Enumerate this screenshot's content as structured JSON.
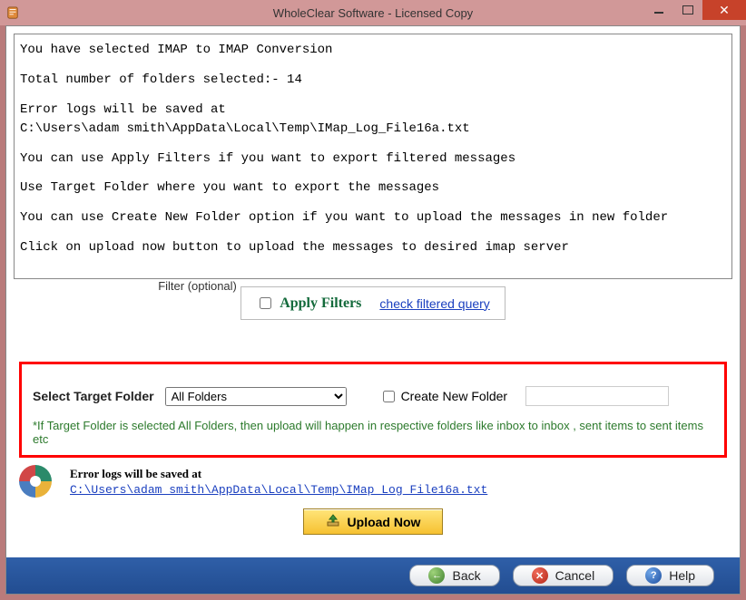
{
  "window": {
    "title": "WholeClear Software - Licensed Copy"
  },
  "info": {
    "line_selected": "You have selected IMAP to IMAP Conversion",
    "line_total": "Total number of folders selected:- 14",
    "line_errors": "Error logs will be saved at",
    "line_error_path": "C:\\Users\\adam smith\\AppData\\Local\\Temp\\IMap_Log_File16a.txt",
    "line_filters": "You can use Apply Filters if you want to export filtered messages",
    "line_target": "Use Target Folder where you want to export the messages",
    "line_create": "You can use Create New Folder option if you want to upload the messages in new folder",
    "line_upload": "Click on upload now button to upload the messages to desired imap server"
  },
  "filter": {
    "legend": "Filter (optional)",
    "apply_label": "Apply Filters",
    "check_label": "check filtered query"
  },
  "target": {
    "label": "Select Target Folder",
    "selected": "All Folders",
    "create_label": "Create New Folder",
    "create_value": "",
    "note": "*If Target Folder is selected All Folders, then upload will happen in respective folders like inbox to inbox , sent items to sent items etc"
  },
  "logs": {
    "heading": "Error logs will be saved at",
    "path": "C:\\Users\\adam smith\\AppData\\Local\\Temp\\IMap_Log_File16a.txt"
  },
  "buttons": {
    "upload": "Upload Now",
    "back": "Back",
    "cancel": "Cancel",
    "help": "Help"
  }
}
